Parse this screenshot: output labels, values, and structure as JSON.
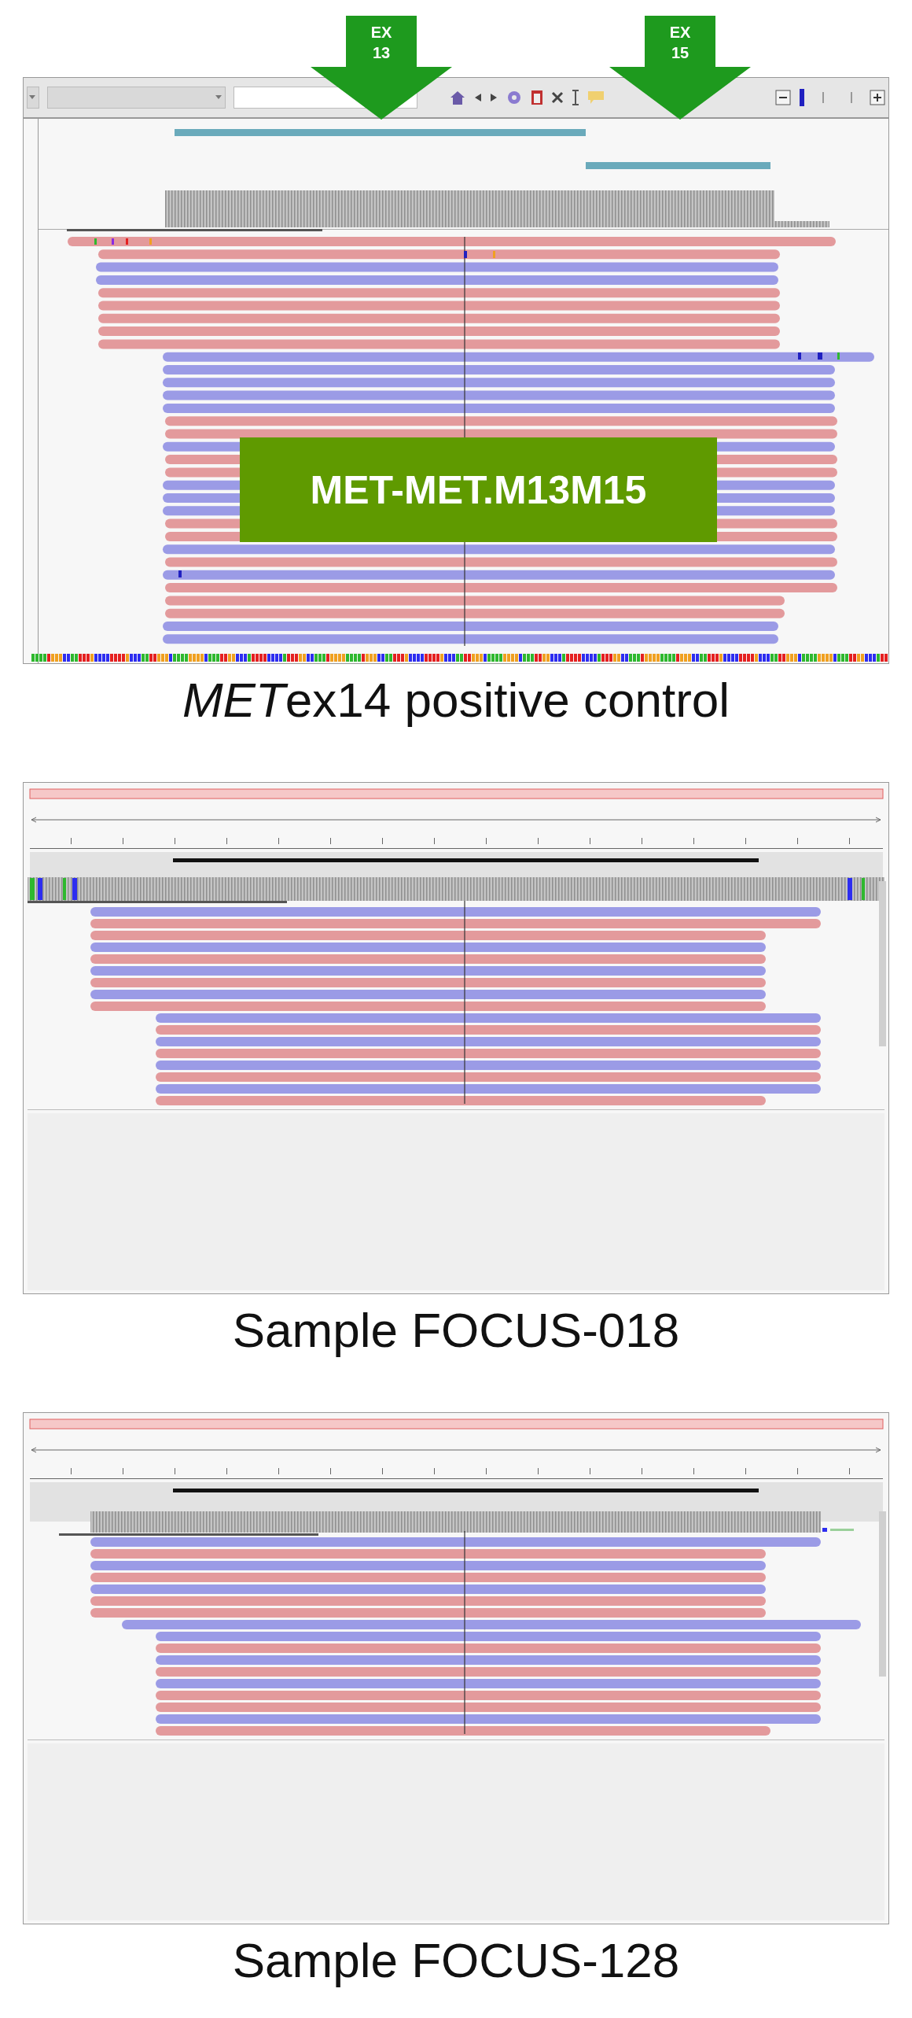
{
  "panels": [
    {
      "kind": "toolbar_view",
      "arrows": [
        {
          "label": "EX 13"
        },
        {
          "label": "EX 15"
        }
      ],
      "overlay_label": "MET-MET.M13M15",
      "caption": [
        {
          "text": "MET",
          "italic": true
        },
        {
          "text": "ex14 positive control",
          "italic": false
        }
      ]
    },
    {
      "kind": "ruler_view",
      "caption": [
        {
          "text": "Sample FOCUS-018",
          "italic": false
        }
      ]
    },
    {
      "kind": "ruler_view_b",
      "caption": [
        {
          "text": "Sample FOCUS-128",
          "italic": false
        }
      ]
    }
  ]
}
